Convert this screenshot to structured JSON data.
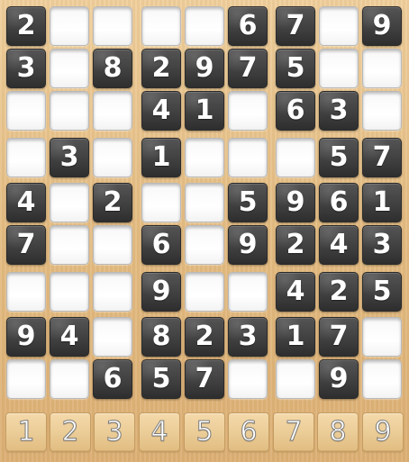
{
  "game": {
    "rows": [
      [
        "2",
        "",
        "",
        "",
        "",
        "6",
        "7",
        "",
        "9"
      ],
      [
        "3",
        "",
        "8",
        "2",
        "9",
        "7",
        "5",
        "",
        ""
      ],
      [
        "",
        "",
        "",
        "4",
        "1",
        "",
        "6",
        "3",
        ""
      ],
      [
        "",
        "3",
        "",
        "1",
        "",
        "",
        "",
        "5",
        "7"
      ],
      [
        "4",
        "",
        "2",
        "",
        "",
        "5",
        "9",
        "6",
        "1"
      ],
      [
        "7",
        "",
        "",
        "6",
        "",
        "9",
        "2",
        "4",
        "3"
      ],
      [
        "",
        "",
        "",
        "9",
        "",
        "",
        "4",
        "2",
        "5"
      ],
      [
        "9",
        "4",
        "",
        "8",
        "2",
        "3",
        "1",
        "7",
        ""
      ],
      [
        "",
        "",
        "6",
        "5",
        "7",
        "",
        "",
        "9",
        ""
      ]
    ]
  },
  "number_pad": {
    "labels": [
      "1",
      "2",
      "3",
      "4",
      "5",
      "6",
      "7",
      "8",
      "9"
    ]
  },
  "colors": {
    "tile": "#404040",
    "empty_cell": "#ffffff",
    "wood": "#e7c58f",
    "digit": "#ffffff"
  }
}
